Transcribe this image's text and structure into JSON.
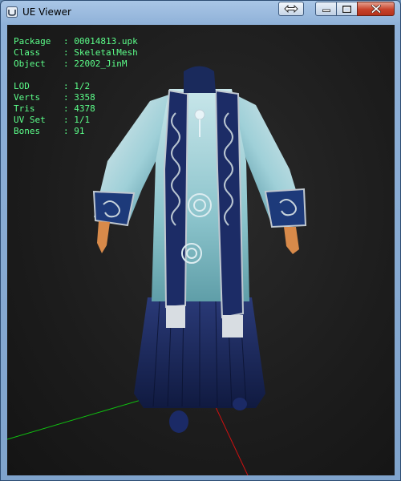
{
  "window": {
    "title": "UE Viewer",
    "icon": "ue-viewer-app-icon",
    "buttons": {
      "extra": "swap-arrows-icon",
      "minimize": "minimize-icon",
      "maximize": "maximize-icon",
      "close": "close-icon"
    }
  },
  "info": {
    "package_label": "Package",
    "package": "00014813.upk",
    "class_label": "Class",
    "class": "SkeletalMesh",
    "object_label": "Object",
    "object": "22002_JinM",
    "lod_label": "LOD",
    "lod": "1/2",
    "verts_label": "Verts",
    "verts": "3358",
    "tris_label": "Tris",
    "tris": "4378",
    "uvset_label": "UV Set",
    "uvset": "1/1",
    "bones_label": "Bones",
    "bones": "91"
  },
  "colors": {
    "info_text": "#5cff8a",
    "viewport_bg": "#1c1c1c",
    "axis_x": "#d01010",
    "axis_y": "#10c010",
    "robe_dark": "#1a2a5c",
    "robe_light": "#a8d6dc"
  }
}
